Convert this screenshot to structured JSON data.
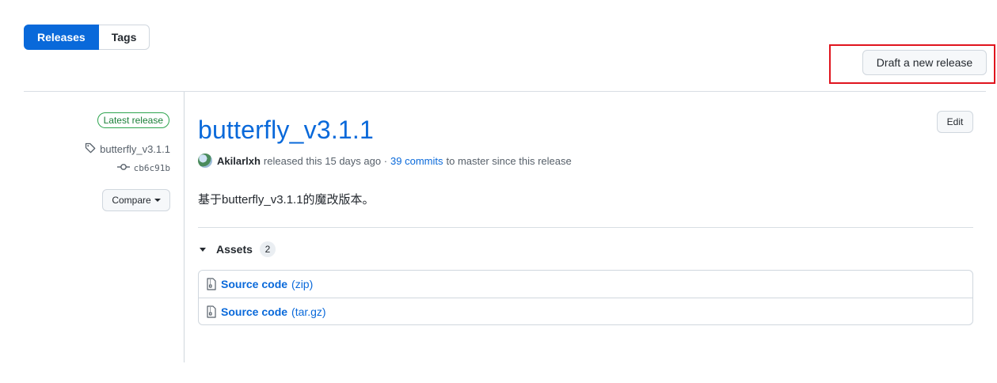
{
  "tabs": [
    {
      "label": "Releases",
      "selected": true
    },
    {
      "label": "Tags",
      "selected": false
    }
  ],
  "actions": {
    "draft_release": "Draft a new release"
  },
  "sidebar": {
    "latest_badge": "Latest release",
    "tag": "butterfly_v3.1.1",
    "commit": "cb6c91b",
    "compare_label": "Compare"
  },
  "release": {
    "title": "butterfly_v3.1.1",
    "edit_label": "Edit",
    "author": "Akilarlxh",
    "released_text": "released this 15 days ago ·",
    "commits_link": "39 commits",
    "commits_suffix": "to master since this release",
    "description": "基于butterfly_v3.1.1的魔改版本。"
  },
  "assets": {
    "label": "Assets",
    "count": "2",
    "items": [
      {
        "name": "Source code",
        "ext": "(zip)"
      },
      {
        "name": "Source code",
        "ext": "(tar.gz)"
      }
    ]
  },
  "colors": {
    "accent": "#0969da",
    "highlight": "#e0141e",
    "latest_green": "#1a7f37"
  }
}
